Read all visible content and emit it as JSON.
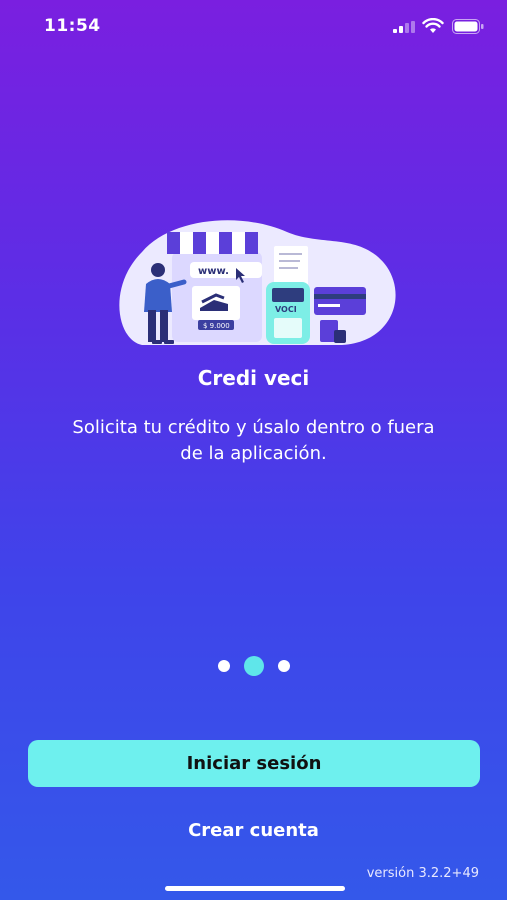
{
  "status_bar": {
    "time": "11:54",
    "icons": [
      "signal-icon",
      "wifi-icon",
      "battery-icon"
    ]
  },
  "illustration": {
    "name": "online-store-illustration",
    "labels": {
      "url": "www.",
      "price": "$ 9.000",
      "pos": "VOCI"
    }
  },
  "onboarding": {
    "title": "Credi veci",
    "subtitle": "Solicita tu crédito y úsalo dentro o fuera de la aplicación.",
    "pages": 3,
    "active_page": 2
  },
  "actions": {
    "login_label": "Iniciar sesión",
    "create_account_label": "Crear cuenta"
  },
  "footer": {
    "version": "versión 3.2.2+49"
  },
  "colors": {
    "gradient_top": "#7a1fe0",
    "gradient_bottom": "#3458ea",
    "accent": "#6ef0ee"
  }
}
